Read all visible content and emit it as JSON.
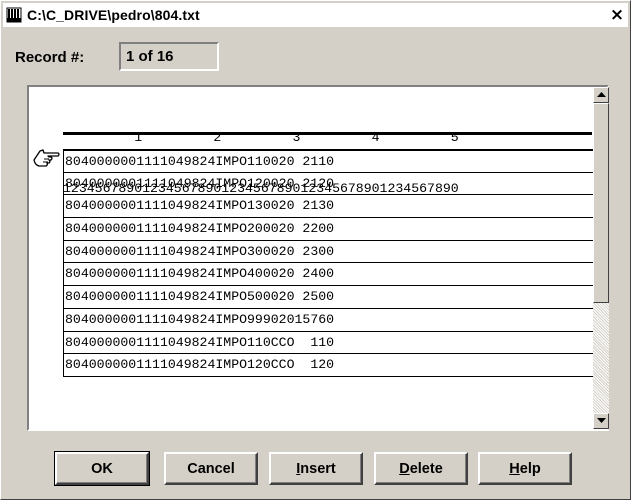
{
  "window": {
    "title": "C:\\C_DRIVE\\pedro\\804.txt",
    "close_symbol": "×"
  },
  "record": {
    "label": "Record #:",
    "value": "1 of 16"
  },
  "ruler": {
    "tens": "         1         2         3         4         5",
    "units": "12345678901234567890123456789012345678901234567890"
  },
  "records": [
    "8040000001111049824IMPO110020 2110",
    "8040000001111049824IMPO120020 2120",
    "8040000001111049824IMPO130020 2130",
    "8040000001111049824IMPO200020 2200",
    "8040000001111049824IMPO300020 2300",
    "8040000001111049824IMPO400020 2400",
    "8040000001111049824IMPO500020 2500",
    "8040000001111049824IMPO99902015760",
    "8040000001111049824IMPO110CCO  110",
    "8040000001111049824IMPO120CCO  120"
  ],
  "buttons": {
    "ok": "OK",
    "cancel": "Cancel",
    "insert_first": "I",
    "insert_rest": "nsert",
    "delete_first": "D",
    "delete_rest": "elete",
    "help_first": "H",
    "help_rest": "elp"
  },
  "icons": {
    "app": "document-app-icon",
    "pointer": "pointing-hand-icon",
    "scroll_up": "arrow-up-icon",
    "scroll_down": "arrow-down-icon"
  }
}
